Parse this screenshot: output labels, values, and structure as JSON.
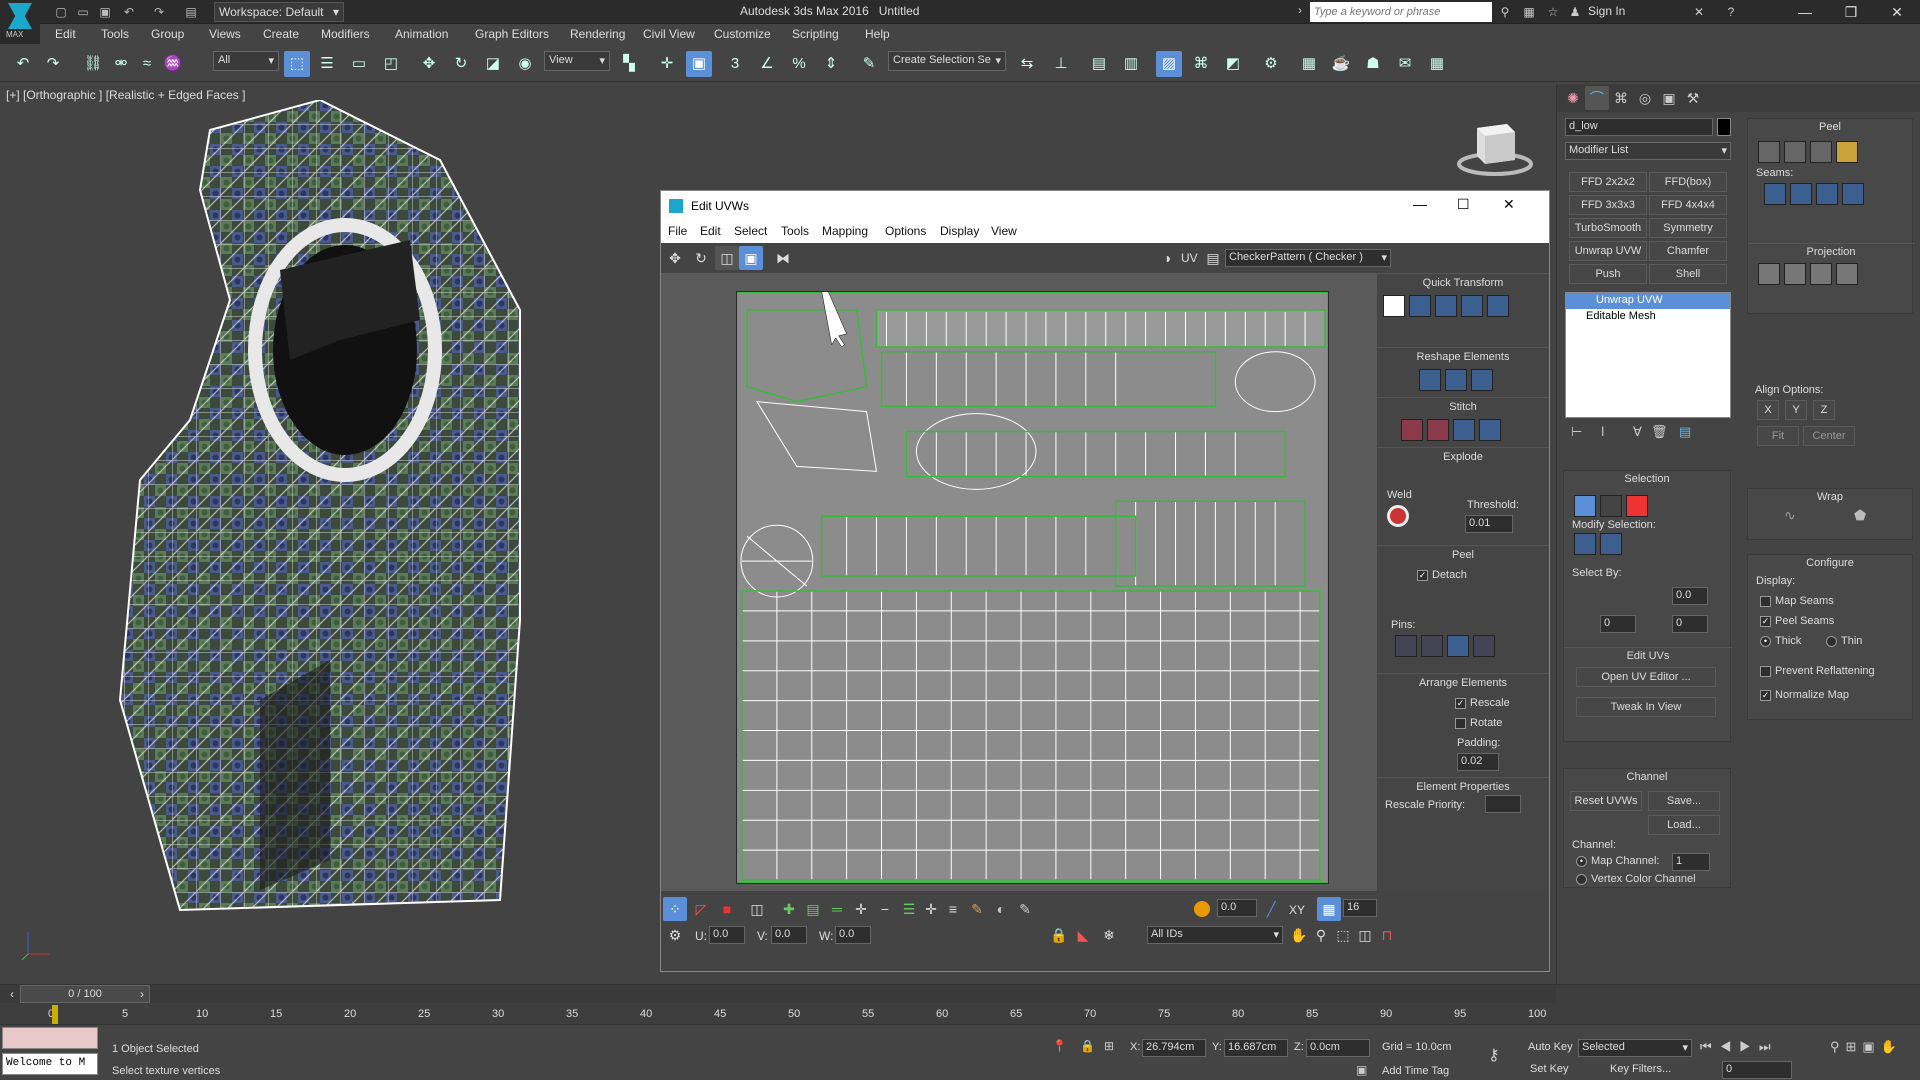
{
  "app": {
    "title": "Autodesk 3ds Max 2016",
    "doc": "Untitled",
    "workspace": "Workspace: Default",
    "search_placeholder": "Type a keyword or phrase",
    "signin": "Sign In",
    "logo_text": "MAX"
  },
  "menus": [
    "Edit",
    "Tools",
    "Group",
    "Views",
    "Create",
    "Modifiers",
    "Animation",
    "Graph Editors",
    "Rendering",
    "Civil View",
    "Customize",
    "Scripting",
    "Help"
  ],
  "toolbar": {
    "filter": "All",
    "view": "View",
    "selection_set": "Create Selection Se"
  },
  "viewport": {
    "label": "[+] [Orthographic ] [Realistic + Edged Faces ]"
  },
  "uv_editor": {
    "title": "Edit UVWs",
    "menus": [
      "File",
      "Edit",
      "Select",
      "Tools",
      "Mapping",
      "Options",
      "Display",
      "View"
    ],
    "uv_label": "UV",
    "checker": "CheckerPattern  ( Checker )",
    "sections": {
      "quick_transform": "Quick Transform",
      "reshape": "Reshape Elements",
      "stitch": "Stitch",
      "explode": "Explode",
      "weld": "Weld",
      "threshold": "Threshold:",
      "threshold_val": "0.01",
      "peel": "Peel",
      "detach": "Detach",
      "pins": "Pins:",
      "arrange": "Arrange Elements",
      "rescale": "Rescale",
      "rotate": "Rotate",
      "padding": "Padding:",
      "padding_val": "0.02",
      "element_props": "Element Properties",
      "rescale_priority": "Rescale Priority:"
    },
    "bottom": {
      "u": "U:",
      "u_val": "0.0",
      "v": "V:",
      "v_val": "0.0",
      "w": "W:",
      "w_val": "0.0",
      "soft": "0.0",
      "xy": "XY",
      "num16": "16",
      "ids": "All IDs"
    }
  },
  "cmd": {
    "object_name": "d_low",
    "modifier_list": "Modifier List",
    "modifier_buttons": [
      "FFD 2x2x2",
      "FFD(box)",
      "FFD 3x3x3",
      "FFD 4x4x4",
      "TurboSmooth",
      "Symmetry",
      "Unwrap UVW",
      "Chamfer",
      "Push",
      "Shell"
    ],
    "stack": [
      "Unwrap UVW",
      "Editable Mesh"
    ],
    "selection": "Selection",
    "modify_selection": "Modify Selection:",
    "select_by": "Select By:",
    "sel_val1": "0.0",
    "sel_val2": "0",
    "sel_val3": "0",
    "edit_uvs": "Edit UVs",
    "open_uv_editor": "Open UV Editor ...",
    "tweak_in_view": "Tweak In View",
    "channel": "Channel",
    "reset_uvws": "Reset UVWs",
    "save": "Save...",
    "load": "Load...",
    "channel_label": "Channel:",
    "map_channel": "Map Channel:",
    "map_channel_val": "1",
    "vertex_color_channel": "Vertex Color Channel",
    "peel": "Peel",
    "seams": "Seams:",
    "projection": "Projection",
    "align_options": "Align Options:",
    "align_x": "X",
    "align_y": "Y",
    "align_z": "Z",
    "fit": "Fit",
    "center": "Center",
    "wrap": "Wrap",
    "configure": "Configure",
    "display": "Display:",
    "map_seams": "Map Seams",
    "peel_seams": "Peel Seams",
    "thick": "Thick",
    "thin": "Thin",
    "prevent_reflattening": "Prevent Reflattening",
    "normalize_map": "Normalize Map"
  },
  "timeline": {
    "frame": "0 / 100",
    "ticks": [
      "0",
      "5",
      "10",
      "15",
      "20",
      "25",
      "30",
      "35",
      "40",
      "45",
      "50",
      "55",
      "60",
      "65",
      "70",
      "75",
      "80",
      "85",
      "90",
      "95",
      "100"
    ]
  },
  "status": {
    "script": "Welcome to M",
    "selected": "1 Object Selected",
    "prompt": "Select texture vertices",
    "x_label": "X:",
    "x_val": "26.794cm",
    "y_label": "Y:",
    "y_val": "16.687cm",
    "z_label": "Z:",
    "z_val": "0.0cm",
    "grid": "Grid = 10.0cm",
    "add_time_tag": "Add Time Tag",
    "auto_key": "Auto Key",
    "set_key": "Set Key",
    "key_mode": "Selected",
    "key_filters": "Key Filters...",
    "frame_val": "0"
  }
}
